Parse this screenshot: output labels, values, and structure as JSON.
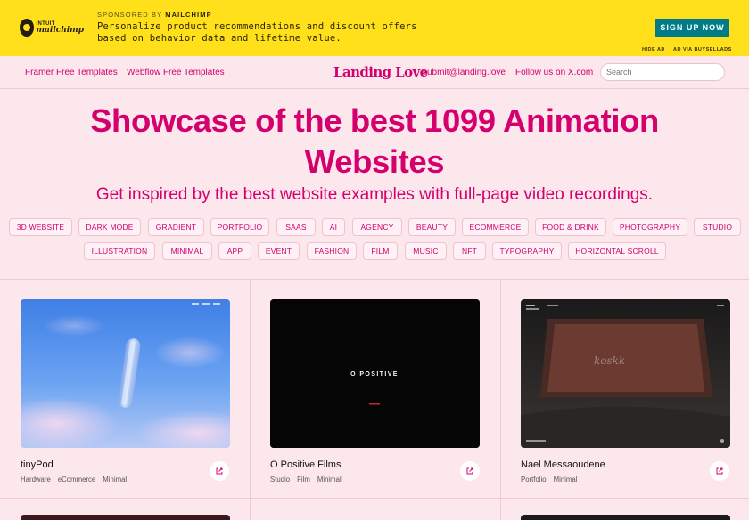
{
  "ad": {
    "logo_line1": "INTUIT",
    "logo_line2": "mailchimp",
    "sponsored_prefix": "SPONSORED BY",
    "sponsor": "MAILCHIMP",
    "text": "Personalize product recommendations and discount offers based on behavior data and lifetime value.",
    "cta": "SIGN UP NOW",
    "hide": "HIDE AD",
    "via": "AD VIA BUYSELLADS"
  },
  "nav": {
    "framer": "Framer Free Templates",
    "webflow": "Webflow Free Templates",
    "logo": "Landing Love",
    "submit": "submit@landing.love",
    "follow": "Follow us on X.com",
    "search_placeholder": "Search"
  },
  "hero": {
    "title_line1": "Showcase of the best 1099 Animation",
    "title_line2": "Websites",
    "subtitle": "Get inspired by the best website examples with full-page video recordings."
  },
  "tags_row1": [
    "3D WEBSITE",
    "DARK MODE",
    "GRADIENT",
    "PORTFOLIO",
    "SAAS",
    "AI",
    "AGENCY",
    "BEAUTY",
    "ECOMMERCE",
    "FOOD & DRINK",
    "PHOTOGRAPHY",
    "STUDIO"
  ],
  "tags_row2": [
    "ILLUSTRATION",
    "MINIMAL",
    "APP",
    "EVENT",
    "FASHION",
    "FILM",
    "MUSIC",
    "NFT",
    "TYPOGRAPHY",
    "HORIZONTAL SCROLL"
  ],
  "cards": [
    {
      "title": "tinyPod",
      "tags": [
        "Hardware",
        "eCommerce",
        "Minimal"
      ]
    },
    {
      "title": "O Positive Films",
      "tags": [
        "Studio",
        "Film",
        "Minimal"
      ],
      "thumb_text": "O POSITIVE"
    },
    {
      "title": "Nael Messaoudene",
      "tags": [
        "Portfolio",
        "Minimal"
      ],
      "thumb_text": "koskk"
    }
  ],
  "colors": {
    "accent": "#d3006e",
    "background": "#fce7ec",
    "ad_yellow": "#ffe01b",
    "cta": "#007c89"
  },
  "icons": {
    "external": "external-link-icon",
    "search": "search-icon"
  }
}
